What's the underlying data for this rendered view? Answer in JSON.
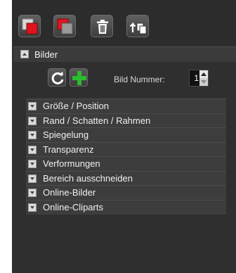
{
  "toolbar": {
    "buttons": [
      {
        "name": "copy-red-icon"
      },
      {
        "name": "copy-gray-icon"
      },
      {
        "name": "delete-icon"
      },
      {
        "name": "upload-copy-icon"
      }
    ]
  },
  "section": {
    "title": "Bilder",
    "expanded": true
  },
  "controls": {
    "refresh_icon": "refresh-icon",
    "add_icon": "add-icon",
    "number_label": "Bild Nummer:",
    "number_value": "1"
  },
  "groups": [
    {
      "label": "Größe / Position"
    },
    {
      "label": "Rand / Schatten / Rahmen"
    },
    {
      "label": "Spiegelung"
    },
    {
      "label": "Transparenz"
    },
    {
      "label": "Verformungen"
    },
    {
      "label": "Bereich ausschneiden"
    },
    {
      "label": "Online-Bilder"
    },
    {
      "label": "Online-Cliparts"
    }
  ],
  "colors": {
    "panel_bg": "#2f2f2f",
    "accent_red": "#e0141e",
    "accent_green": "#2bbd2e",
    "refresh_blue": "#3b8fd8"
  }
}
